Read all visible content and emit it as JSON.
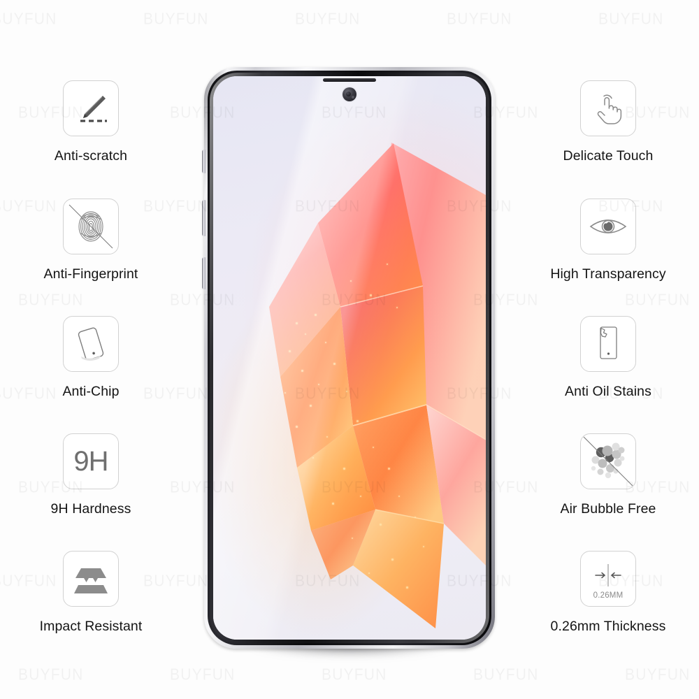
{
  "brand": {
    "watermark_text": "BUYFUN"
  },
  "product": {
    "device_type": "smartphone",
    "screen_wallpaper": "faceted-crystal-pink-orange"
  },
  "features_left": [
    {
      "id": "anti-scratch",
      "label": "Anti-scratch",
      "icon": "pencil-scratch-icon"
    },
    {
      "id": "anti-fingerprint",
      "label": "Anti-Fingerprint",
      "icon": "fingerprint-icon"
    },
    {
      "id": "anti-chip",
      "label": "Anti-Chip",
      "icon": "phone-tilted-icon"
    },
    {
      "id": "hardness",
      "label": "9H Hardness",
      "icon": "hardness-9h-icon",
      "glyph": "9H"
    },
    {
      "id": "impact-resistant",
      "label": "Impact Resistant",
      "icon": "layers-impact-icon"
    }
  ],
  "features_right": [
    {
      "id": "delicate-touch",
      "label": "Delicate Touch",
      "icon": "touch-hand-icon"
    },
    {
      "id": "high-transparency",
      "label": "High Transparency",
      "icon": "eye-icon"
    },
    {
      "id": "anti-oil-stains",
      "label": "Anti Oil Stains",
      "icon": "phone-oil-stain-icon"
    },
    {
      "id": "air-bubble-free",
      "label": "Air Bubble Free",
      "icon": "bubbles-crossed-icon"
    },
    {
      "id": "thickness",
      "label": "0.26mm Thickness",
      "icon": "thickness-arrows-icon",
      "inner_text": "0.26MM"
    }
  ],
  "colors": {
    "icon_border": "#d2d2d2",
    "icon_gray": "#6f6f6f",
    "label_text": "#141414",
    "background": "#fdfdfd",
    "accent_orange": "#ff7a3c",
    "accent_pink": "#f8556d"
  }
}
